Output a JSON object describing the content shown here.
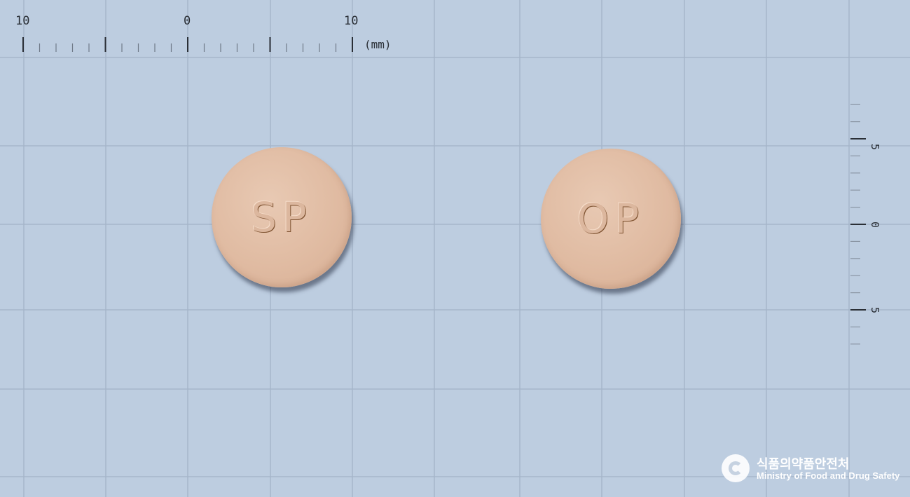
{
  "scale_top": {
    "labels": [
      "10",
      "0",
      "10"
    ],
    "unit": "(mm)"
  },
  "scale_right": {
    "labels": [
      "5",
      "0",
      "5"
    ]
  },
  "pills": [
    {
      "imprint": "SP",
      "color": "#e0bba2"
    },
    {
      "imprint": "OP",
      "color": "#e0bba2"
    }
  ],
  "logo": {
    "korean": "식품의약품안전처",
    "english": "Ministry of Food and Drug Safety"
  },
  "colors": {
    "background": "#bdcde0",
    "grid": "#a6b6ca",
    "ruler": "#2a2f36"
  }
}
